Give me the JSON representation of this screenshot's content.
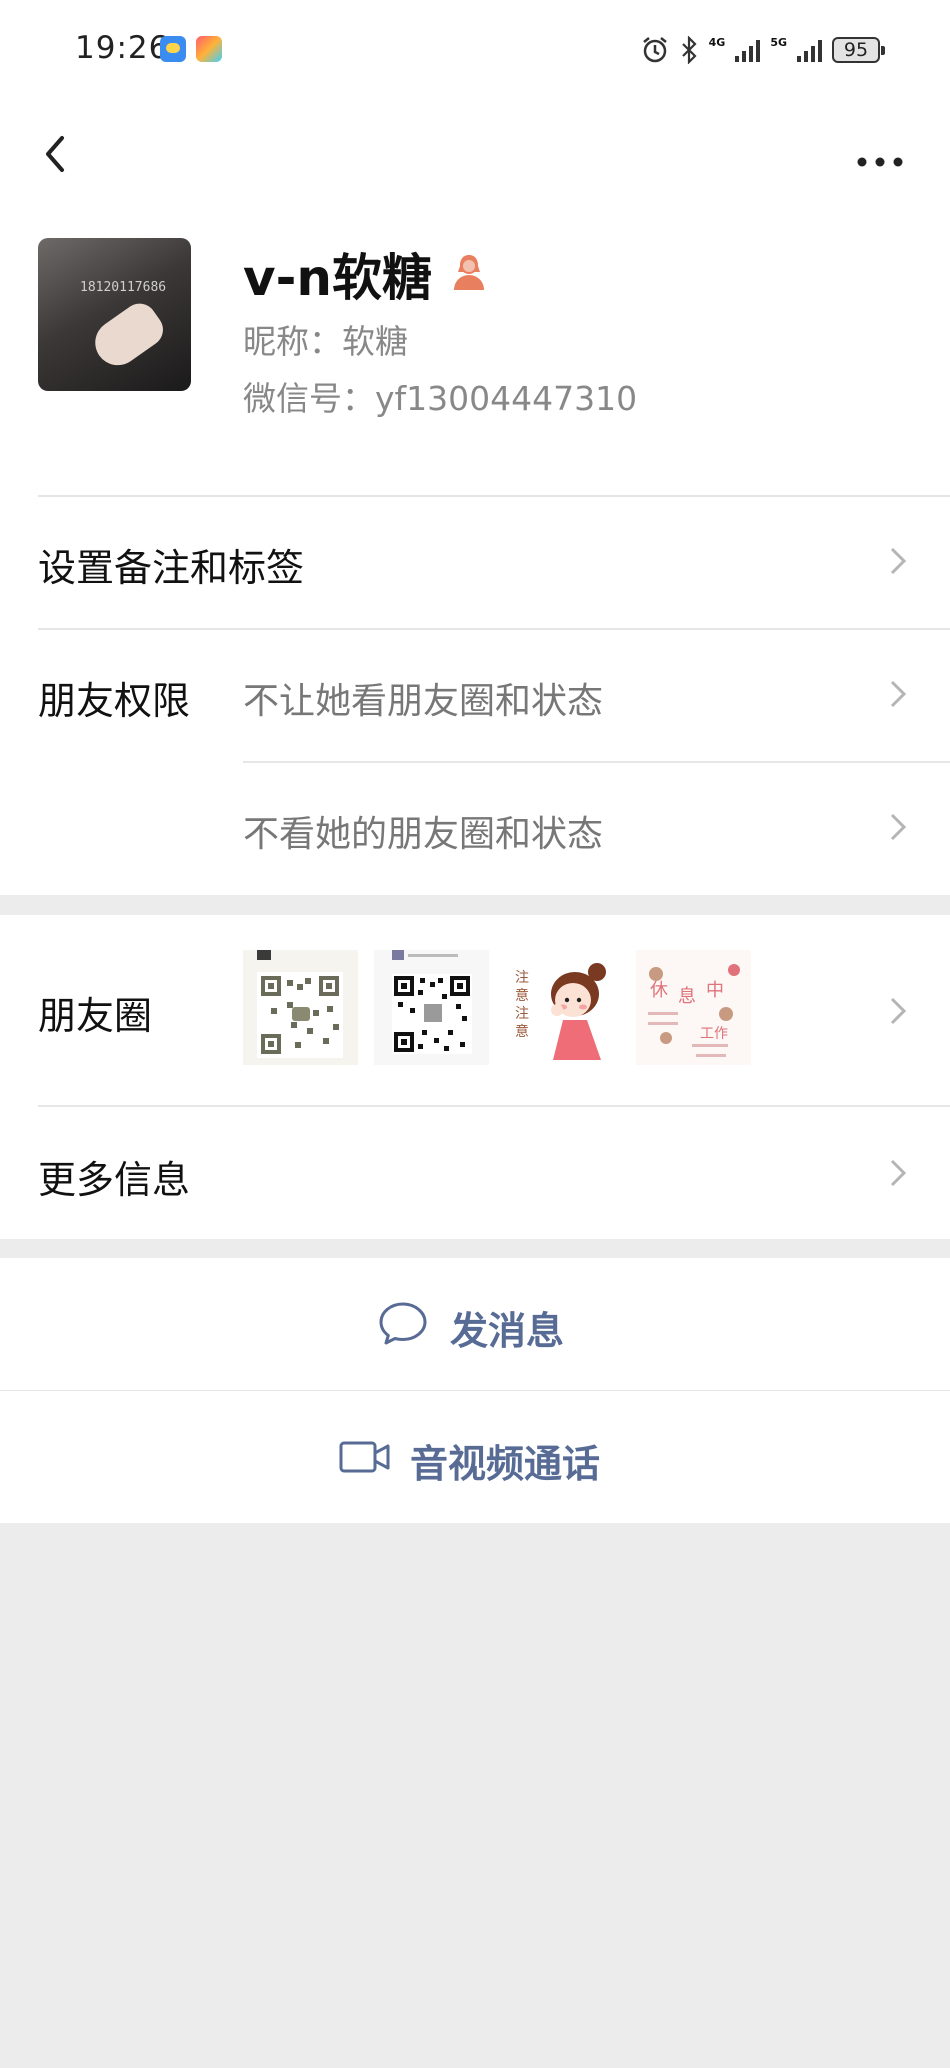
{
  "status_bar": {
    "time": "19:26",
    "net1": "4G",
    "net2": "5G",
    "battery": "95"
  },
  "profile": {
    "display_name": "v-n软糖",
    "nickname": "昵称：软糖",
    "wechat_id": "微信号：yf13004447310",
    "avatar_text": "18120117686",
    "gender": "female"
  },
  "rows": {
    "remark_label": "设置备注和标签",
    "privacy_label": "朋友权限",
    "privacy_opt1": "不让她看朋友圈和状态",
    "privacy_opt2": "不看她的朋友圈和状态",
    "moments_label": "朋友圈",
    "more_info_label": "更多信息"
  },
  "moments_thumbs": {
    "t3_text": "注意注意",
    "t4_text": "休息中"
  },
  "actions": {
    "message_label": "发消息",
    "video_label": "音视频通话"
  },
  "colors": {
    "link": "#576b95",
    "divider": "#e6e6e6",
    "background": "#ececec",
    "female_badge": "#e8805f"
  }
}
